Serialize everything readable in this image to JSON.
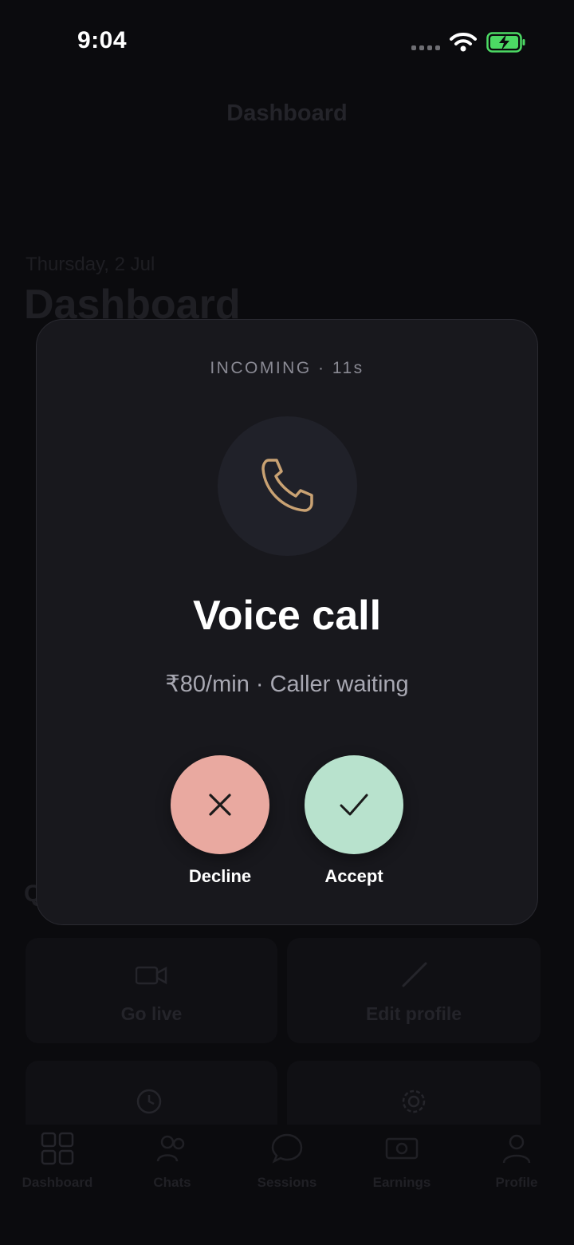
{
  "status_bar": {
    "time": "9:04"
  },
  "background": {
    "header_title": "Dashboard",
    "date": "Thursday, 2 Jul",
    "page_heading": "Dashboard",
    "section_letter": "Q",
    "cards": [
      {
        "label": "Go live"
      },
      {
        "label": "Edit profile"
      }
    ],
    "tabs": [
      {
        "label": "Dashboard",
        "icon": "grid-icon"
      },
      {
        "label": "Chats",
        "icon": "users-icon"
      },
      {
        "label": "Sessions",
        "icon": "chat-bubble-icon"
      },
      {
        "label": "Earnings",
        "icon": "money-icon"
      },
      {
        "label": "Profile",
        "icon": "person-icon"
      }
    ]
  },
  "modal": {
    "status": "INCOMING · 11s",
    "icon": "phone-icon",
    "title": "Voice call",
    "subtitle": "₹80/min · Caller waiting",
    "decline_label": "Decline",
    "accept_label": "Accept"
  },
  "colors": {
    "accent_phone": "#c9a273",
    "decline": "#e9a9a0",
    "accept": "#b8e2cd",
    "battery": "#4cd964"
  }
}
